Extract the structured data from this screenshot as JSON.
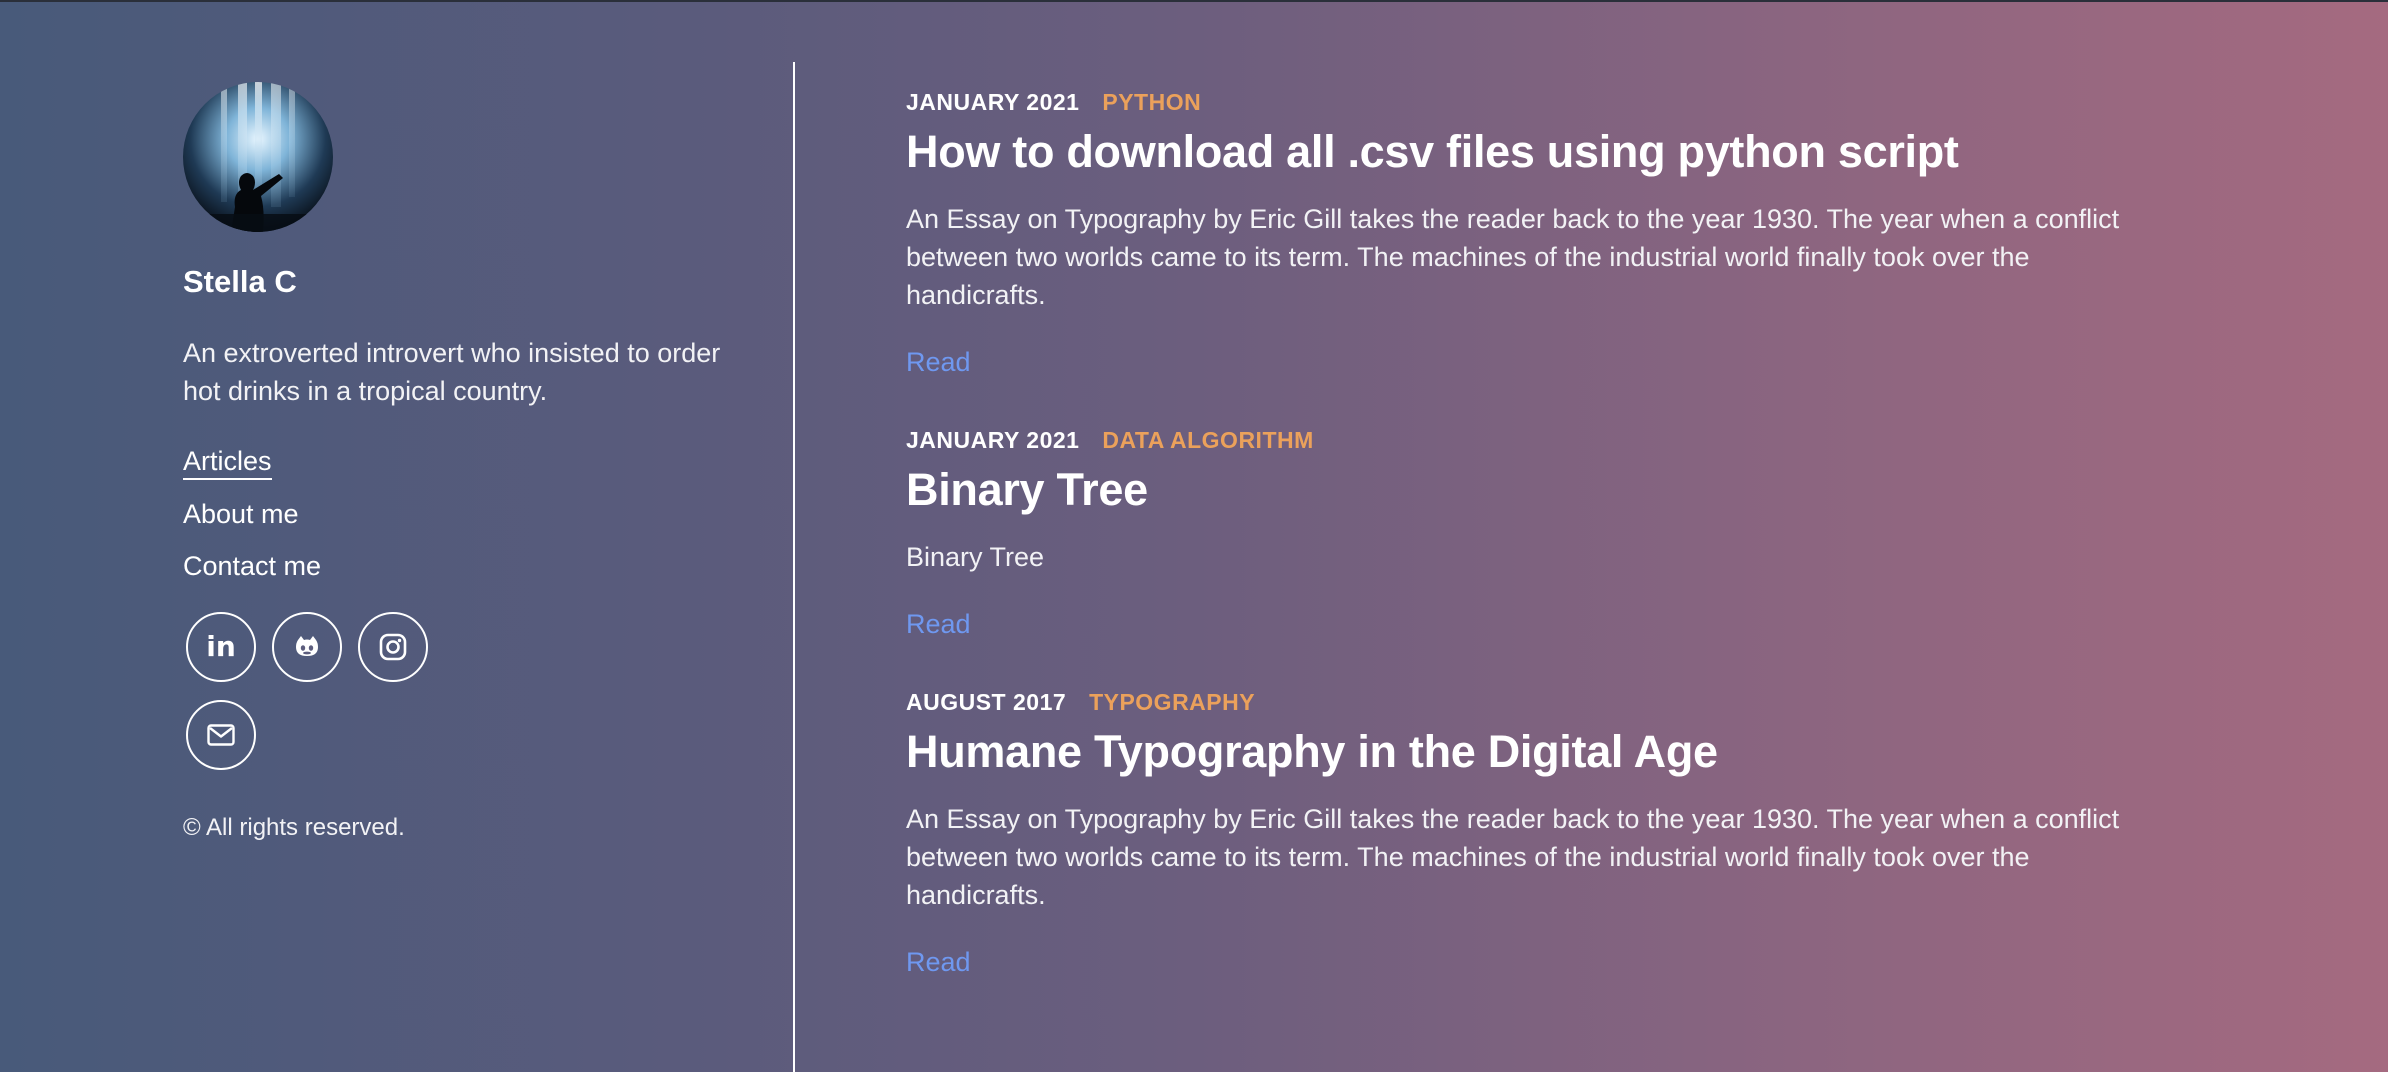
{
  "profile": {
    "name": "Stella C",
    "bio": "An extroverted introvert who insisted to order hot drinks in a tropical country.",
    "avatar_icon": "waterfall-silhouette-avatar"
  },
  "nav": {
    "items": [
      {
        "label": "Articles",
        "active": true
      },
      {
        "label": "About me",
        "active": false
      },
      {
        "label": "Contact me",
        "active": false
      }
    ]
  },
  "socials": [
    {
      "icon": "linkedin-icon",
      "glyph": "in"
    },
    {
      "icon": "github-icon"
    },
    {
      "icon": "instagram-icon"
    },
    {
      "icon": "mail-icon"
    }
  ],
  "footer": {
    "copyright": "© All rights reserved."
  },
  "posts": [
    {
      "date": "JANUARY 2021",
      "category": "PYTHON",
      "title": "How to download all .csv files using python script",
      "excerpt": "An Essay on Typography by Eric Gill takes the reader back to the year 1930. The year when a conflict between two worlds came to its term. The machines of the industrial world finally took over the handicrafts.",
      "read_label": "Read"
    },
    {
      "date": "JANUARY 2021",
      "category": "DATA ALGORITHM",
      "title": "Binary Tree",
      "excerpt": "Binary Tree",
      "read_label": "Read"
    },
    {
      "date": "AUGUST 2017",
      "category": "TYPOGRAPHY",
      "title": "Humane Typography in the Digital Age",
      "excerpt": "An Essay on Typography by Eric Gill takes the reader back to the year 1930. The year when a conflict between two worlds came to its term. The machines of the industrial world finally took over the handicrafts.",
      "read_label": "Read"
    }
  ],
  "colors": {
    "accent_category": "#eba15b",
    "link": "#6f98f0",
    "gradient_start": "#485a7a",
    "gradient_end": "#a56a80"
  }
}
